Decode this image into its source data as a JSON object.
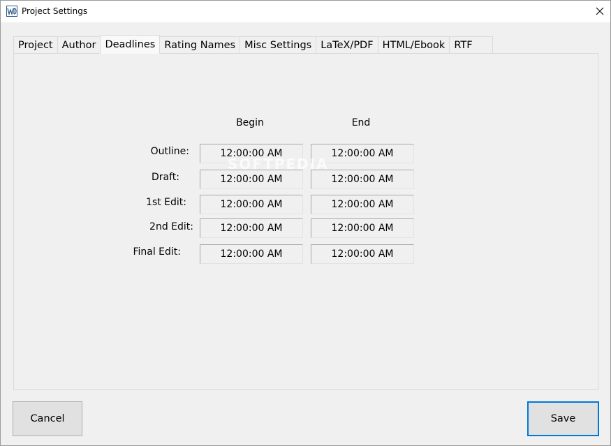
{
  "window": {
    "title": "Project Settings"
  },
  "icons": {
    "app": "yw-app-icon",
    "close": "close-icon"
  },
  "tabs": [
    {
      "label": "Project",
      "active": false
    },
    {
      "label": "Author",
      "active": false
    },
    {
      "label": "Deadlines",
      "active": true
    },
    {
      "label": "Rating Names",
      "active": false
    },
    {
      "label": "Misc Settings",
      "active": false
    },
    {
      "label": "LaTeX/PDF",
      "active": false
    },
    {
      "label": "HTML/Ebook",
      "active": false
    },
    {
      "label": "RTF",
      "active": false
    }
  ],
  "deadlines": {
    "columns": {
      "begin": "Begin",
      "end": "End"
    },
    "rows": [
      {
        "label": "Outline:",
        "begin": "12:00:00 AM",
        "end": "12:00:00 AM"
      },
      {
        "label": "Draft:",
        "begin": "12:00:00 AM",
        "end": "12:00:00 AM"
      },
      {
        "label": "1st Edit:",
        "begin": "12:00:00 AM",
        "end": "12:00:00 AM"
      },
      {
        "label": "2nd Edit:",
        "begin": "12:00:00 AM",
        "end": "12:00:00 AM"
      },
      {
        "label": "Final Edit:",
        "begin": "12:00:00 AM",
        "end": "12:00:00 AM"
      }
    ]
  },
  "buttons": {
    "cancel": "Cancel",
    "save": "Save"
  },
  "watermark": "SOFTPEDIA",
  "colors": {
    "focus_border": "#0078d7"
  }
}
